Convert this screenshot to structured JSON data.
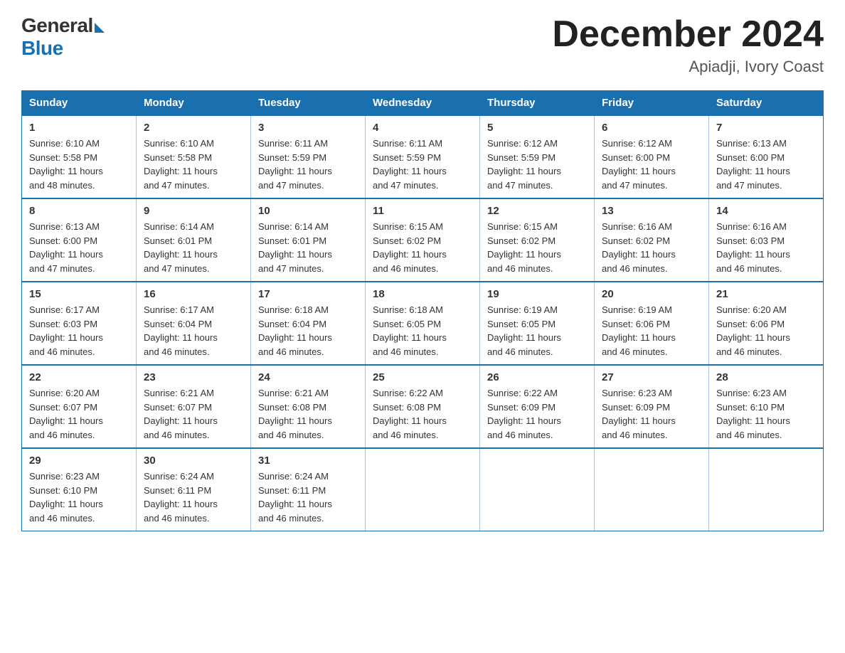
{
  "header": {
    "logo_general": "General",
    "logo_blue": "Blue",
    "month_year": "December 2024",
    "location": "Apiadji, Ivory Coast"
  },
  "weekdays": [
    "Sunday",
    "Monday",
    "Tuesday",
    "Wednesday",
    "Thursday",
    "Friday",
    "Saturday"
  ],
  "weeks": [
    [
      {
        "day": "1",
        "sunrise": "6:10 AM",
        "sunset": "5:58 PM",
        "daylight": "11 hours and 48 minutes."
      },
      {
        "day": "2",
        "sunrise": "6:10 AM",
        "sunset": "5:58 PM",
        "daylight": "11 hours and 47 minutes."
      },
      {
        "day": "3",
        "sunrise": "6:11 AM",
        "sunset": "5:59 PM",
        "daylight": "11 hours and 47 minutes."
      },
      {
        "day": "4",
        "sunrise": "6:11 AM",
        "sunset": "5:59 PM",
        "daylight": "11 hours and 47 minutes."
      },
      {
        "day": "5",
        "sunrise": "6:12 AM",
        "sunset": "5:59 PM",
        "daylight": "11 hours and 47 minutes."
      },
      {
        "day": "6",
        "sunrise": "6:12 AM",
        "sunset": "6:00 PM",
        "daylight": "11 hours and 47 minutes."
      },
      {
        "day": "7",
        "sunrise": "6:13 AM",
        "sunset": "6:00 PM",
        "daylight": "11 hours and 47 minutes."
      }
    ],
    [
      {
        "day": "8",
        "sunrise": "6:13 AM",
        "sunset": "6:00 PM",
        "daylight": "11 hours and 47 minutes."
      },
      {
        "day": "9",
        "sunrise": "6:14 AM",
        "sunset": "6:01 PM",
        "daylight": "11 hours and 47 minutes."
      },
      {
        "day": "10",
        "sunrise": "6:14 AM",
        "sunset": "6:01 PM",
        "daylight": "11 hours and 47 minutes."
      },
      {
        "day": "11",
        "sunrise": "6:15 AM",
        "sunset": "6:02 PM",
        "daylight": "11 hours and 46 minutes."
      },
      {
        "day": "12",
        "sunrise": "6:15 AM",
        "sunset": "6:02 PM",
        "daylight": "11 hours and 46 minutes."
      },
      {
        "day": "13",
        "sunrise": "6:16 AM",
        "sunset": "6:02 PM",
        "daylight": "11 hours and 46 minutes."
      },
      {
        "day": "14",
        "sunrise": "6:16 AM",
        "sunset": "6:03 PM",
        "daylight": "11 hours and 46 minutes."
      }
    ],
    [
      {
        "day": "15",
        "sunrise": "6:17 AM",
        "sunset": "6:03 PM",
        "daylight": "11 hours and 46 minutes."
      },
      {
        "day": "16",
        "sunrise": "6:17 AM",
        "sunset": "6:04 PM",
        "daylight": "11 hours and 46 minutes."
      },
      {
        "day": "17",
        "sunrise": "6:18 AM",
        "sunset": "6:04 PM",
        "daylight": "11 hours and 46 minutes."
      },
      {
        "day": "18",
        "sunrise": "6:18 AM",
        "sunset": "6:05 PM",
        "daylight": "11 hours and 46 minutes."
      },
      {
        "day": "19",
        "sunrise": "6:19 AM",
        "sunset": "6:05 PM",
        "daylight": "11 hours and 46 minutes."
      },
      {
        "day": "20",
        "sunrise": "6:19 AM",
        "sunset": "6:06 PM",
        "daylight": "11 hours and 46 minutes."
      },
      {
        "day": "21",
        "sunrise": "6:20 AM",
        "sunset": "6:06 PM",
        "daylight": "11 hours and 46 minutes."
      }
    ],
    [
      {
        "day": "22",
        "sunrise": "6:20 AM",
        "sunset": "6:07 PM",
        "daylight": "11 hours and 46 minutes."
      },
      {
        "day": "23",
        "sunrise": "6:21 AM",
        "sunset": "6:07 PM",
        "daylight": "11 hours and 46 minutes."
      },
      {
        "day": "24",
        "sunrise": "6:21 AM",
        "sunset": "6:08 PM",
        "daylight": "11 hours and 46 minutes."
      },
      {
        "day": "25",
        "sunrise": "6:22 AM",
        "sunset": "6:08 PM",
        "daylight": "11 hours and 46 minutes."
      },
      {
        "day": "26",
        "sunrise": "6:22 AM",
        "sunset": "6:09 PM",
        "daylight": "11 hours and 46 minutes."
      },
      {
        "day": "27",
        "sunrise": "6:23 AM",
        "sunset": "6:09 PM",
        "daylight": "11 hours and 46 minutes."
      },
      {
        "day": "28",
        "sunrise": "6:23 AM",
        "sunset": "6:10 PM",
        "daylight": "11 hours and 46 minutes."
      }
    ],
    [
      {
        "day": "29",
        "sunrise": "6:23 AM",
        "sunset": "6:10 PM",
        "daylight": "11 hours and 46 minutes."
      },
      {
        "day": "30",
        "sunrise": "6:24 AM",
        "sunset": "6:11 PM",
        "daylight": "11 hours and 46 minutes."
      },
      {
        "day": "31",
        "sunrise": "6:24 AM",
        "sunset": "6:11 PM",
        "daylight": "11 hours and 46 minutes."
      },
      null,
      null,
      null,
      null
    ]
  ],
  "labels": {
    "sunrise": "Sunrise:",
    "sunset": "Sunset:",
    "daylight": "Daylight:"
  }
}
